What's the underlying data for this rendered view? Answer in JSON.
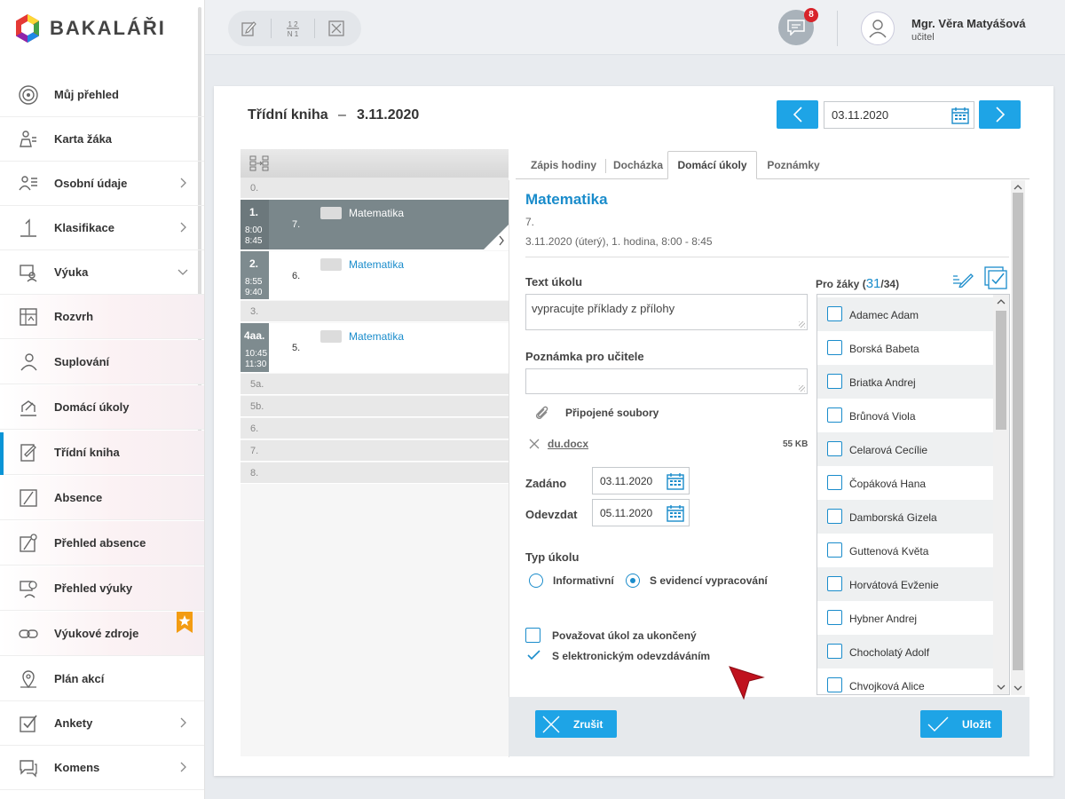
{
  "app": {
    "name": "BAKALÁŘI"
  },
  "sidebar": {
    "items": [
      {
        "label": "Můj přehled",
        "icon": "target-icon"
      },
      {
        "label": "Karta žáka",
        "icon": "student-card-icon"
      },
      {
        "label": "Osobní údaje",
        "icon": "personal-data-icon",
        "expandable": true
      },
      {
        "label": "Klasifikace",
        "icon": "grade-icon",
        "expandable": true
      },
      {
        "label": "Výuka",
        "icon": "teaching-icon",
        "expanded": true
      },
      {
        "label": "Rozvrh",
        "icon": "timetable-icon"
      },
      {
        "label": "Suplování",
        "icon": "substitution-icon"
      },
      {
        "label": "Domácí úkoly",
        "icon": "homework-icon"
      },
      {
        "label": "Třídní kniha",
        "icon": "class-book-icon",
        "active": true
      },
      {
        "label": "Absence",
        "icon": "absence-icon"
      },
      {
        "label": "Přehled absence",
        "icon": "absence-overview-icon"
      },
      {
        "label": "Přehled výuky",
        "icon": "teaching-overview-icon"
      },
      {
        "label": "Výukové zdroje",
        "icon": "resources-icon",
        "badge": "star-bookmark-icon"
      },
      {
        "label": "Plán akcí",
        "icon": "map-pin-icon"
      },
      {
        "label": "Ankety",
        "icon": "poll-icon",
        "expandable": true
      },
      {
        "label": "Komens",
        "icon": "chat-icon",
        "expandable": true
      }
    ]
  },
  "header": {
    "tools": [
      "edit-icon",
      "fraction-icon",
      "close-box-icon"
    ],
    "messages_count": "8",
    "user_name": "Mgr. Věra Matyášová",
    "user_role": "učitel"
  },
  "page": {
    "title": "Třídní kniha",
    "dash": "–",
    "date": "3.11.2020",
    "date_field": "03.11.2020"
  },
  "lessons": [
    {
      "num": "0.",
      "empty": true
    },
    {
      "num": "1.",
      "time_from": "8:00",
      "time_to": "8:45",
      "group": "7.",
      "subject": "Matematika",
      "selected": true
    },
    {
      "num": "2.",
      "time_from": "8:55",
      "time_to": "9:40",
      "group": "6.",
      "subject": "Matematika"
    },
    {
      "num": "3.",
      "empty": true
    },
    {
      "num": "4aa.",
      "time_from": "10:45",
      "time_to": "11:30",
      "group": "5.",
      "subject": "Matematika"
    },
    {
      "num": "5a.",
      "empty": true
    },
    {
      "num": "5b.",
      "empty": true
    },
    {
      "num": "6.",
      "empty": true
    },
    {
      "num": "7.",
      "empty": true
    },
    {
      "num": "8.",
      "empty": true
    }
  ],
  "tabs": [
    "Zápis hodiny",
    "Docházka",
    "Domácí úkoly",
    "Poznámky"
  ],
  "detail": {
    "subject": "Matematika",
    "group": "7.",
    "when": "3.11.2020 (úterý), 1. hodina, 8:00 - 8:45",
    "task_label": "Text úkolu",
    "task_text": "vypracujte příklady z přílohy",
    "note_label": "Poznámka pro učitele",
    "note_text": "",
    "files_label": "Připojené soubory",
    "file_name": "du.docx",
    "file_size": "55 KB",
    "assigned_label": "Zadáno",
    "assigned_date": "03.11.2020",
    "due_label": "Odevzdat",
    "due_date": "05.11.2020",
    "type_label": "Typ úkolu",
    "type_informative": "Informativní",
    "type_tracked": "S evidencí vypracování",
    "type_selected": "tracked",
    "finished_label": "Považovat úkol za ukončený",
    "finished": false,
    "electronic_label": "S elektronickým odevzdáváním",
    "electronic": true,
    "students_label": "Pro žáky (",
    "students_selected": "31",
    "students_total": "/34)",
    "students": [
      "Adamec Adam",
      "Borská Babeta",
      "Briatka Andrej",
      "Brůnová Viola",
      "Celarová Cecílie",
      "Čopáková Hana",
      "Damborská Gizela",
      "Guttenová Květa",
      "Horvátová Evženie",
      "Hybner Andrej",
      "Chocholatý Adolf",
      "Chvojková Alice"
    ]
  },
  "footer": {
    "cancel": "Zrušit",
    "save": "Uložit"
  },
  "colors": {
    "accent": "#1ea4e6",
    "link": "#1a8ccb",
    "badge": "#d8232a",
    "selected_row": "#7a878b"
  }
}
